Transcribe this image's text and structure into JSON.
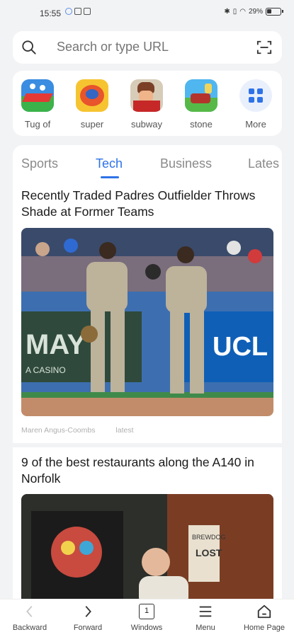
{
  "status_bar": {
    "time": "15:55",
    "battery": "29%"
  },
  "search": {
    "placeholder": "Search or type URL"
  },
  "shortcuts": [
    {
      "label": "Tug of",
      "icon": "tug-of-war-app-icon"
    },
    {
      "label": "super",
      "icon": "super-app-icon"
    },
    {
      "label": "subway",
      "icon": "subway-surfers-app-icon"
    },
    {
      "label": "stone",
      "icon": "stone-app-icon"
    },
    {
      "label": "More",
      "icon": "grid-icon"
    }
  ],
  "tabs": [
    {
      "label": "Sports",
      "active": false
    },
    {
      "label": "Tech",
      "active": true
    },
    {
      "label": "Business",
      "active": false
    },
    {
      "label": "Lates",
      "active": false
    }
  ],
  "articles": [
    {
      "title": "Recently Traded Padres Outfielder Throws Shade at Former Teams",
      "author": "Maren Angus-Coombs",
      "tag": "latest"
    },
    {
      "title": "9 of the best restaurants along the A140 in Norfolk"
    }
  ],
  "bottom_nav": [
    {
      "label": "Backward",
      "icon": "chevron-left-icon",
      "enabled": false
    },
    {
      "label": "Forward",
      "icon": "chevron-right-icon",
      "enabled": true
    },
    {
      "label": "Windows",
      "icon": "windows-count-icon",
      "enabled": true,
      "count": "1"
    },
    {
      "label": "Menu",
      "icon": "hamburger-menu-icon",
      "enabled": true
    },
    {
      "label": "Home Page",
      "icon": "home-icon",
      "enabled": true
    }
  ],
  "colors": {
    "accent": "#2f72e8",
    "background": "#f2f3f5"
  }
}
